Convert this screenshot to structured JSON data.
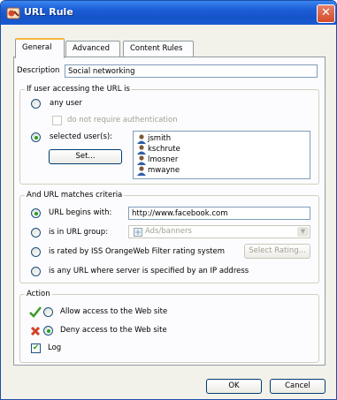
{
  "window": {
    "title": "URL Rule",
    "close_glyph": "✕",
    "icon": "url-rule-icon"
  },
  "tabs": [
    {
      "label": "General",
      "active": true
    },
    {
      "label": "Advanced",
      "active": false
    },
    {
      "label": "Content Rules",
      "active": false
    }
  ],
  "description": {
    "label": "Description",
    "value": "Social networking"
  },
  "user_group": {
    "title": "If user accessing the URL is",
    "any_user_label": "any user",
    "no_auth_label": "do not require authentication",
    "selected_users_label": "selected user(s):",
    "set_button": "Set...",
    "users": [
      "jsmith",
      "kschrute",
      "lmosner",
      "mwayne"
    ],
    "selected_option": "selected users"
  },
  "criteria_group": {
    "title": "And URL matches criteria",
    "begins_with_label": "URL begins with:",
    "begins_with_value": "http://www.facebook.com",
    "in_group_label": "is in URL group:",
    "url_group_value": "Ads/banners",
    "rated_label": "is rated by ISS OrangeWeb Filter rating system",
    "select_rating_button": "Select Rating...",
    "ip_label": "is any URL where server is specified by an IP address",
    "selected_option": "URL begins with"
  },
  "action_group": {
    "title": "Action",
    "allow_label": "Allow access to the Web site",
    "deny_label": "Deny access to the Web site",
    "log_label": "Log",
    "selected_option": "deny",
    "log_checked": true,
    "check_mark": "✔"
  },
  "buttons": {
    "ok": "OK",
    "cancel": "Cancel"
  },
  "colors": {
    "title_bar": "#1d5fd8",
    "radio_selected": "#21a121",
    "allow_icon": "#3a9a2a",
    "deny_icon": "#d0402a"
  }
}
